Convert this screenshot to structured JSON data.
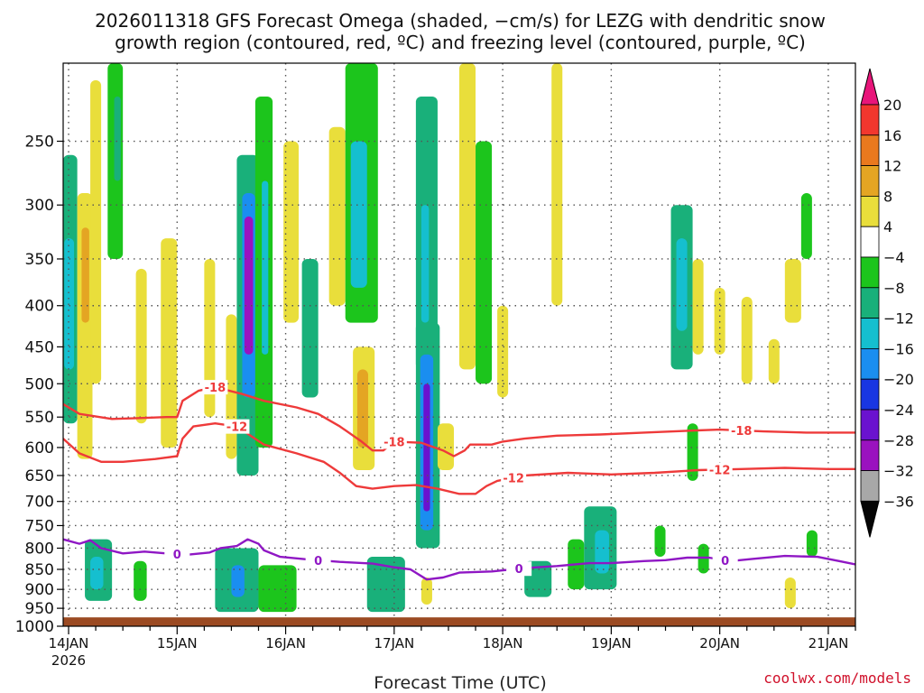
{
  "header": {
    "title_line1": "2026011318 GFS Forecast Omega (shaded, −cm/s) for LEZG with dendritic snow",
    "title_line2": "growth region (contoured, red, ºC) and freezing level (contoured, purple, ºC)"
  },
  "footer": {
    "xlabel": "Forecast Time (UTC)",
    "credit": "coolwx.com/models"
  },
  "colors": {
    "dgz_contour": "#ee3a3a",
    "freezing_contour": "#8f17c4",
    "ground": "#9b4a22",
    "grid": "#555555"
  },
  "chart_data": {
    "type": "heatmap",
    "xlabel": "Forecast Time (UTC)",
    "ylabel": "",
    "grid": true,
    "y_axis": {
      "scale": "log-pressure",
      "inverted": true,
      "range": [
        1000,
        200
      ],
      "ticks": [
        250,
        300,
        350,
        400,
        450,
        500,
        550,
        600,
        650,
        700,
        750,
        800,
        850,
        900,
        950,
        1000
      ]
    },
    "x_axis": {
      "range_days_from_14jan00z": [
        -0.05,
        7.25
      ],
      "ticks": [
        {
          "day": 0,
          "label": "14JAN",
          "sublabel": "2026"
        },
        {
          "day": 1,
          "label": "15JAN",
          "sublabel": ""
        },
        {
          "day": 2,
          "label": "16JAN",
          "sublabel": ""
        },
        {
          "day": 3,
          "label": "17JAN",
          "sublabel": ""
        },
        {
          "day": 4,
          "label": "18JAN",
          "sublabel": ""
        },
        {
          "day": 5,
          "label": "19JAN",
          "sublabel": ""
        },
        {
          "day": 6,
          "label": "20JAN",
          "sublabel": ""
        },
        {
          "day": 7,
          "label": "21JAN",
          "sublabel": ""
        }
      ]
    },
    "colorbar": {
      "labels": [
        "20",
        "16",
        "12",
        "8",
        "4",
        "−4",
        "−8",
        "−12",
        "−16",
        "−20",
        "−24",
        "−28",
        "−32",
        "−36"
      ],
      "colors": [
        "#e8157a",
        "#f2372e",
        "#e9791e",
        "#e4a523",
        "#e9de3b",
        "#ffffff",
        "#1cc51c",
        "#19b07a",
        "#15bfcf",
        "#1a8ef0",
        "#1936e2",
        "#6a12cf",
        "#9a12bf",
        "#a8a8a8",
        "#050505"
      ]
    },
    "contours": [
      {
        "name": "-18",
        "color": "#ee3a3a",
        "label_at": [
          [
            1.35,
            "-18"
          ],
          [
            3.0,
            "-18"
          ],
          [
            6.2,
            "-18"
          ]
        ],
        "points": [
          [
            -0.05,
            530
          ],
          [
            0.1,
            545
          ],
          [
            0.4,
            553
          ],
          [
            0.6,
            552
          ],
          [
            0.9,
            550
          ],
          [
            1.0,
            550
          ],
          [
            1.05,
            525
          ],
          [
            1.2,
            510
          ],
          [
            1.35,
            505
          ],
          [
            1.6,
            515
          ],
          [
            1.8,
            525
          ],
          [
            2.1,
            535
          ],
          [
            2.3,
            545
          ],
          [
            2.5,
            565
          ],
          [
            2.7,
            590
          ],
          [
            2.8,
            605
          ],
          [
            2.9,
            605
          ],
          [
            3.0,
            590
          ],
          [
            3.25,
            592
          ],
          [
            3.45,
            605
          ],
          [
            3.55,
            615
          ],
          [
            3.65,
            605
          ],
          [
            3.7,
            595
          ],
          [
            3.9,
            595
          ],
          [
            4.0,
            590
          ],
          [
            4.2,
            585
          ],
          [
            4.5,
            580
          ],
          [
            4.9,
            578
          ],
          [
            5.3,
            575
          ],
          [
            5.7,
            572
          ],
          [
            6.0,
            570
          ],
          [
            6.4,
            573
          ],
          [
            6.8,
            575
          ],
          [
            7.25,
            575
          ]
        ]
      },
      {
        "name": "-12",
        "color": "#ee3a3a",
        "label_at": [
          [
            1.55,
            "-12"
          ],
          [
            4.1,
            "-12"
          ],
          [
            6.0,
            "-12"
          ]
        ],
        "points": [
          [
            -0.05,
            585
          ],
          [
            0.1,
            610
          ],
          [
            0.3,
            625
          ],
          [
            0.5,
            625
          ],
          [
            0.8,
            620
          ],
          [
            1.0,
            615
          ],
          [
            1.05,
            585
          ],
          [
            1.15,
            565
          ],
          [
            1.35,
            560
          ],
          [
            1.55,
            565
          ],
          [
            1.8,
            595
          ],
          [
            2.1,
            610
          ],
          [
            2.35,
            625
          ],
          [
            2.5,
            645
          ],
          [
            2.65,
            670
          ],
          [
            2.8,
            675
          ],
          [
            3.0,
            670
          ],
          [
            3.2,
            668
          ],
          [
            3.4,
            675
          ],
          [
            3.6,
            685
          ],
          [
            3.75,
            685
          ],
          [
            3.85,
            670
          ],
          [
            3.95,
            660
          ],
          [
            4.2,
            650
          ],
          [
            4.6,
            645
          ],
          [
            5.0,
            648
          ],
          [
            5.4,
            645
          ],
          [
            5.8,
            640
          ],
          [
            6.2,
            638
          ],
          [
            6.6,
            636
          ],
          [
            7.0,
            638
          ],
          [
            7.25,
            638
          ]
        ]
      },
      {
        "name": "0",
        "color": "#8f17c4",
        "label_at": [
          [
            1.0,
            "0"
          ],
          [
            2.3,
            "0"
          ],
          [
            4.15,
            "0"
          ],
          [
            6.05,
            "0"
          ]
        ],
        "points": [
          [
            -0.05,
            780
          ],
          [
            0.1,
            790
          ],
          [
            0.2,
            782
          ],
          [
            0.3,
            800
          ],
          [
            0.5,
            812
          ],
          [
            0.7,
            808
          ],
          [
            0.9,
            812
          ],
          [
            1.1,
            815
          ],
          [
            1.3,
            810
          ],
          [
            1.4,
            800
          ],
          [
            1.55,
            795
          ],
          [
            1.65,
            780
          ],
          [
            1.75,
            790
          ],
          [
            1.8,
            805
          ],
          [
            1.95,
            820
          ],
          [
            2.2,
            826
          ],
          [
            2.5,
            832
          ],
          [
            2.8,
            836
          ],
          [
            3.0,
            845
          ],
          [
            3.15,
            850
          ],
          [
            3.3,
            875
          ],
          [
            3.45,
            870
          ],
          [
            3.6,
            858
          ],
          [
            3.9,
            855
          ],
          [
            4.2,
            847
          ],
          [
            4.5,
            842
          ],
          [
            4.8,
            835
          ],
          [
            5.0,
            835
          ],
          [
            5.3,
            830
          ],
          [
            5.5,
            828
          ],
          [
            5.7,
            822
          ],
          [
            5.9,
            822
          ],
          [
            6.1,
            830
          ],
          [
            6.3,
            825
          ],
          [
            6.6,
            818
          ],
          [
            6.9,
            820
          ],
          [
            7.1,
            830
          ],
          [
            7.25,
            838
          ]
        ]
      }
    ],
    "omega_cells": [
      {
        "t0": -0.05,
        "t1": 0.08,
        "p0": 260,
        "p1": 560,
        "v": -9
      },
      {
        "t0": -0.04,
        "t1": 0.05,
        "p0": 330,
        "p1": 480,
        "v": -14
      },
      {
        "t0": 0.08,
        "t1": 0.22,
        "p0": 290,
        "p1": 620,
        "v": 6
      },
      {
        "t0": 0.12,
        "t1": 0.19,
        "p0": 320,
        "p1": 420,
        "v": 10
      },
      {
        "t0": 0.2,
        "t1": 0.3,
        "p0": 210,
        "p1": 500,
        "v": 5
      },
      {
        "t0": 0.36,
        "t1": 0.5,
        "p0": 200,
        "p1": 350,
        "v": -6
      },
      {
        "t0": 0.42,
        "t1": 0.48,
        "p0": 220,
        "p1": 280,
        "v": -10
      },
      {
        "t0": 0.62,
        "t1": 0.72,
        "p0": 360,
        "p1": 560,
        "v": 5
      },
      {
        "t0": 0.85,
        "t1": 1.0,
        "p0": 330,
        "p1": 600,
        "v": 5
      },
      {
        "t0": 1.25,
        "t1": 1.35,
        "p0": 350,
        "p1": 550,
        "v": 5
      },
      {
        "t0": 1.45,
        "t1": 1.55,
        "p0": 410,
        "p1": 620,
        "v": 6
      },
      {
        "t0": 1.55,
        "t1": 1.75,
        "p0": 260,
        "p1": 650,
        "v": -8
      },
      {
        "t0": 1.6,
        "t1": 1.72,
        "p0": 290,
        "p1": 520,
        "v": -16
      },
      {
        "t0": 1.62,
        "t1": 1.7,
        "p0": 310,
        "p1": 460,
        "v": -28
      },
      {
        "t0": 1.72,
        "t1": 1.88,
        "p0": 220,
        "p1": 600,
        "v": -6
      },
      {
        "t0": 1.78,
        "t1": 1.84,
        "p0": 280,
        "p1": 460,
        "v": -14
      },
      {
        "t0": 1.98,
        "t1": 2.12,
        "p0": 250,
        "p1": 420,
        "v": 5
      },
      {
        "t0": 2.15,
        "t1": 2.3,
        "p0": 350,
        "p1": 520,
        "v": -8
      },
      {
        "t0": 2.4,
        "t1": 2.55,
        "p0": 240,
        "p1": 400,
        "v": 5
      },
      {
        "t0": 2.55,
        "t1": 2.85,
        "p0": 200,
        "p1": 420,
        "v": -7
      },
      {
        "t0": 2.6,
        "t1": 2.75,
        "p0": 250,
        "p1": 380,
        "v": -13
      },
      {
        "t0": 2.62,
        "t1": 2.82,
        "p0": 450,
        "p1": 640,
        "v": 6
      },
      {
        "t0": 2.66,
        "t1": 2.76,
        "p0": 480,
        "p1": 600,
        "v": 10
      },
      {
        "t0": 3.2,
        "t1": 3.4,
        "p0": 220,
        "p1": 480,
        "v": -8
      },
      {
        "t0": 3.25,
        "t1": 3.32,
        "p0": 300,
        "p1": 420,
        "v": -14
      },
      {
        "t0": 3.2,
        "t1": 3.42,
        "p0": 420,
        "p1": 800,
        "v": -10
      },
      {
        "t0": 3.24,
        "t1": 3.36,
        "p0": 460,
        "p1": 760,
        "v": -18
      },
      {
        "t0": 3.27,
        "t1": 3.33,
        "p0": 500,
        "p1": 720,
        "v": -24
      },
      {
        "t0": 3.4,
        "t1": 3.55,
        "p0": 560,
        "p1": 640,
        "v": 5
      },
      {
        "t0": 3.6,
        "t1": 3.75,
        "p0": 200,
        "p1": 480,
        "v": 5
      },
      {
        "t0": 3.75,
        "t1": 3.9,
        "p0": 250,
        "p1": 500,
        "v": -7
      },
      {
        "t0": 3.95,
        "t1": 4.05,
        "p0": 400,
        "p1": 520,
        "v": 5
      },
      {
        "t0": 4.45,
        "t1": 4.55,
        "p0": 200,
        "p1": 400,
        "v": 5
      },
      {
        "t0": 5.55,
        "t1": 5.75,
        "p0": 300,
        "p1": 480,
        "v": -8
      },
      {
        "t0": 5.6,
        "t1": 5.7,
        "p0": 330,
        "p1": 430,
        "v": -14
      },
      {
        "t0": 5.7,
        "t1": 5.8,
        "p0": 560,
        "p1": 660,
        "v": -7
      },
      {
        "t0": 5.75,
        "t1": 5.85,
        "p0": 350,
        "p1": 460,
        "v": 5
      },
      {
        "t0": 5.95,
        "t1": 6.05,
        "p0": 380,
        "p1": 460,
        "v": 5
      },
      {
        "t0": 6.2,
        "t1": 6.3,
        "p0": 390,
        "p1": 500,
        "v": 5
      },
      {
        "t0": 6.45,
        "t1": 6.55,
        "p0": 440,
        "p1": 500,
        "v": 5
      },
      {
        "t0": 6.6,
        "t1": 6.75,
        "p0": 350,
        "p1": 420,
        "v": 5
      },
      {
        "t0": 6.75,
        "t1": 6.85,
        "p0": 290,
        "p1": 350,
        "v": -7
      },
      {
        "t0": 0.15,
        "t1": 0.4,
        "p0": 780,
        "p1": 930,
        "v": -9
      },
      {
        "t0": 0.2,
        "t1": 0.32,
        "p0": 820,
        "p1": 900,
        "v": -13
      },
      {
        "t0": 0.6,
        "t1": 0.72,
        "p0": 830,
        "p1": 930,
        "v": -7
      },
      {
        "t0": 1.35,
        "t1": 1.75,
        "p0": 800,
        "p1": 960,
        "v": -9
      },
      {
        "t0": 1.5,
        "t1": 1.62,
        "p0": 840,
        "p1": 920,
        "v": -16
      },
      {
        "t0": 1.75,
        "t1": 2.1,
        "p0": 840,
        "p1": 960,
        "v": -7
      },
      {
        "t0": 2.75,
        "t1": 3.1,
        "p0": 820,
        "p1": 960,
        "v": -8
      },
      {
        "t0": 3.25,
        "t1": 3.35,
        "p0": 870,
        "p1": 940,
        "v": 5
      },
      {
        "t0": 4.2,
        "t1": 4.45,
        "p0": 830,
        "p1": 920,
        "v": -8
      },
      {
        "t0": 4.6,
        "t1": 4.75,
        "p0": 780,
        "p1": 900,
        "v": -7
      },
      {
        "t0": 4.75,
        "t1": 5.05,
        "p0": 710,
        "p1": 900,
        "v": -9
      },
      {
        "t0": 4.85,
        "t1": 4.98,
        "p0": 760,
        "p1": 860,
        "v": -13
      },
      {
        "t0": 5.4,
        "t1": 5.5,
        "p0": 750,
        "p1": 820,
        "v": -7
      },
      {
        "t0": 5.8,
        "t1": 5.9,
        "p0": 790,
        "p1": 860,
        "v": -7
      },
      {
        "t0": 6.6,
        "t1": 6.7,
        "p0": 870,
        "p1": 950,
        "v": 5
      },
      {
        "t0": 6.8,
        "t1": 6.9,
        "p0": 760,
        "p1": 820,
        "v": -7
      }
    ],
    "terrain_pressure": 975
  }
}
